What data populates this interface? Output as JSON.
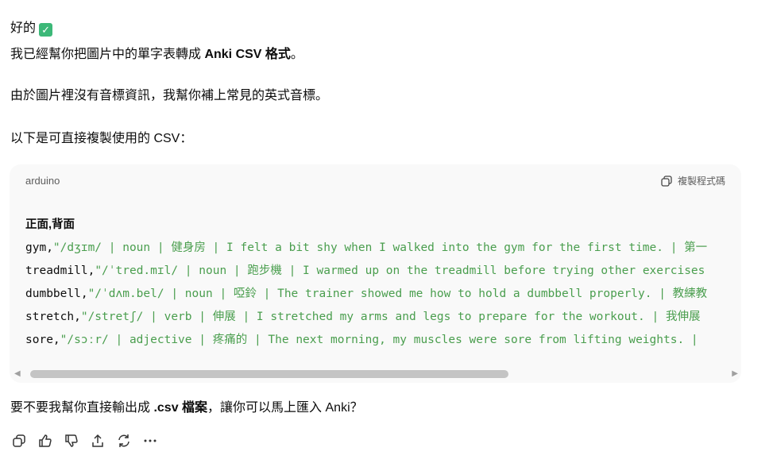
{
  "message": {
    "line1": "好的",
    "line2_pre": "我已經幫你把圖片中的單字表轉成 ",
    "line2_bold": "Anki CSV 格式",
    "line2_post": "。",
    "line3": "由於圖片裡沒有音標資訊，我幫你補上常見的英式音標。",
    "line4": "以下是可直接複製使用的 CSV：",
    "final_pre": "要不要我幫你直接輸出成 ",
    "final_bold": ".csv 檔案",
    "final_post": "，讓你可以馬上匯入 Anki？"
  },
  "code": {
    "language": "arduino",
    "copy_label": "複製程式碼",
    "header": "正面,背面",
    "rows": [
      {
        "word": "gym,",
        "rest": "\"/dʒɪm/ | noun | 健身房 | I felt a bit shy when I walked into the gym for the first time. | 第一"
      },
      {
        "word": "treadmill,",
        "rest": "\"/ˈtred.mɪl/ | noun | 跑步機 | I warmed up on the treadmill before trying other exercises"
      },
      {
        "word": "dumbbell,",
        "rest": "\"/ˈdʌm.bel/ | noun | 啞鈴 | The trainer showed me how to hold a dumbbell properly. | 教練教"
      },
      {
        "word": "stretch,",
        "rest": "\"/stretʃ/ | verb | 伸展 | I stretched my arms and legs to prepare for the workout. | 我伸展"
      },
      {
        "word": "sore,",
        "rest": "\"/sɔːr/ | adjective | 疼痛的 | The next morning, my muscles were sore from lifting weights. |"
      }
    ]
  }
}
